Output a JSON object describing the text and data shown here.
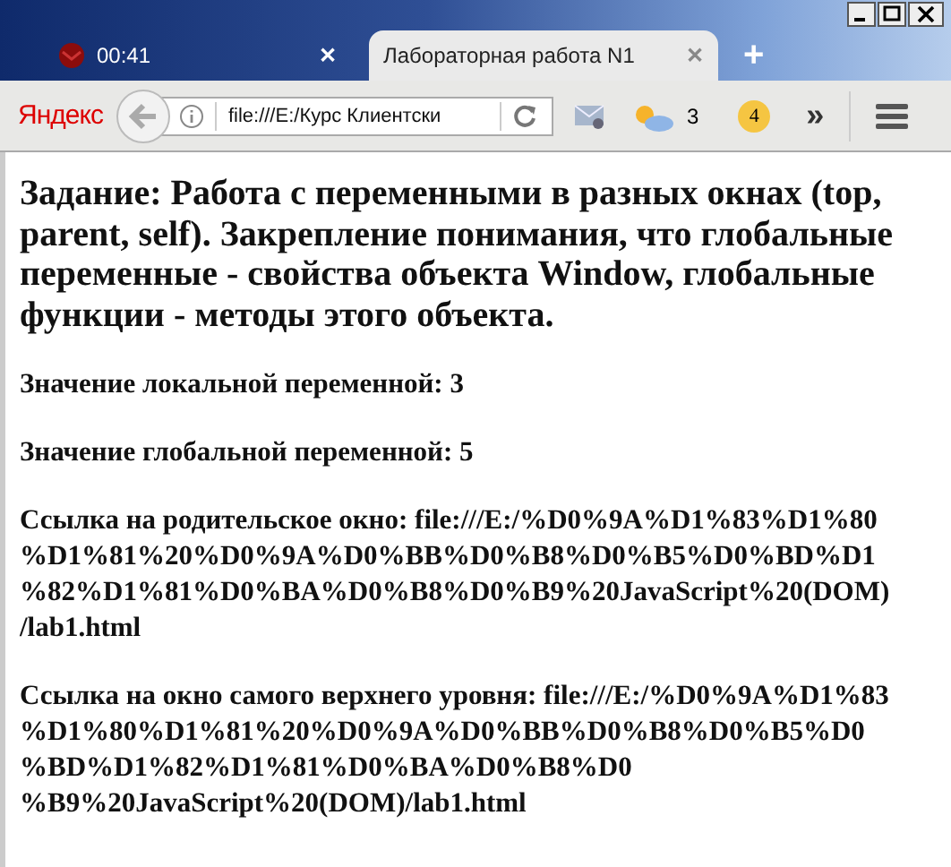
{
  "tabs": [
    {
      "label": "00:41",
      "selected": false,
      "close": "✕"
    },
    {
      "label": "Лабораторная работа N1",
      "selected": true,
      "close": "✕"
    }
  ],
  "new_tab": "+",
  "toolbar": {
    "logo": "Яндекс",
    "address": "file:///E:/Курс Клиентски",
    "weather": "3",
    "badge": "4",
    "overflow": "»"
  },
  "page": {
    "heading": "Задание: Работа с переменными в разных окнах (top, parent, self). Закрепление понимания, что глобальные переменные - свойства объекта Window, глобальные функции - методы этого объекта.",
    "paragraphs": [
      "Значение локальной переменной: 3",
      "Значение глобальной переменной: 5",
      "Ссылка на родительское окно: file:///E:/%D0%9A%D1%83%D1%80 %D1%81%20%D0%9A%D0%BB%D0%B8%D0%B5%D0%BD%D1 %82%D1%81%D0%BA%D0%B8%D0%B9%20JavaScript%20(DOM) /lab1.html",
      "Ссылка на окно самого верхнего уровня: file:///E:/%D0%9A%D1%83 %D1%80%D1%81%20%D0%9A%D0%BB%D0%B8%D0%B5%D0 %BD%D1%82%D1%81%D0%BA%D0%B8%D0 %B9%20JavaScript%20(DOM)/lab1.html"
    ]
  }
}
